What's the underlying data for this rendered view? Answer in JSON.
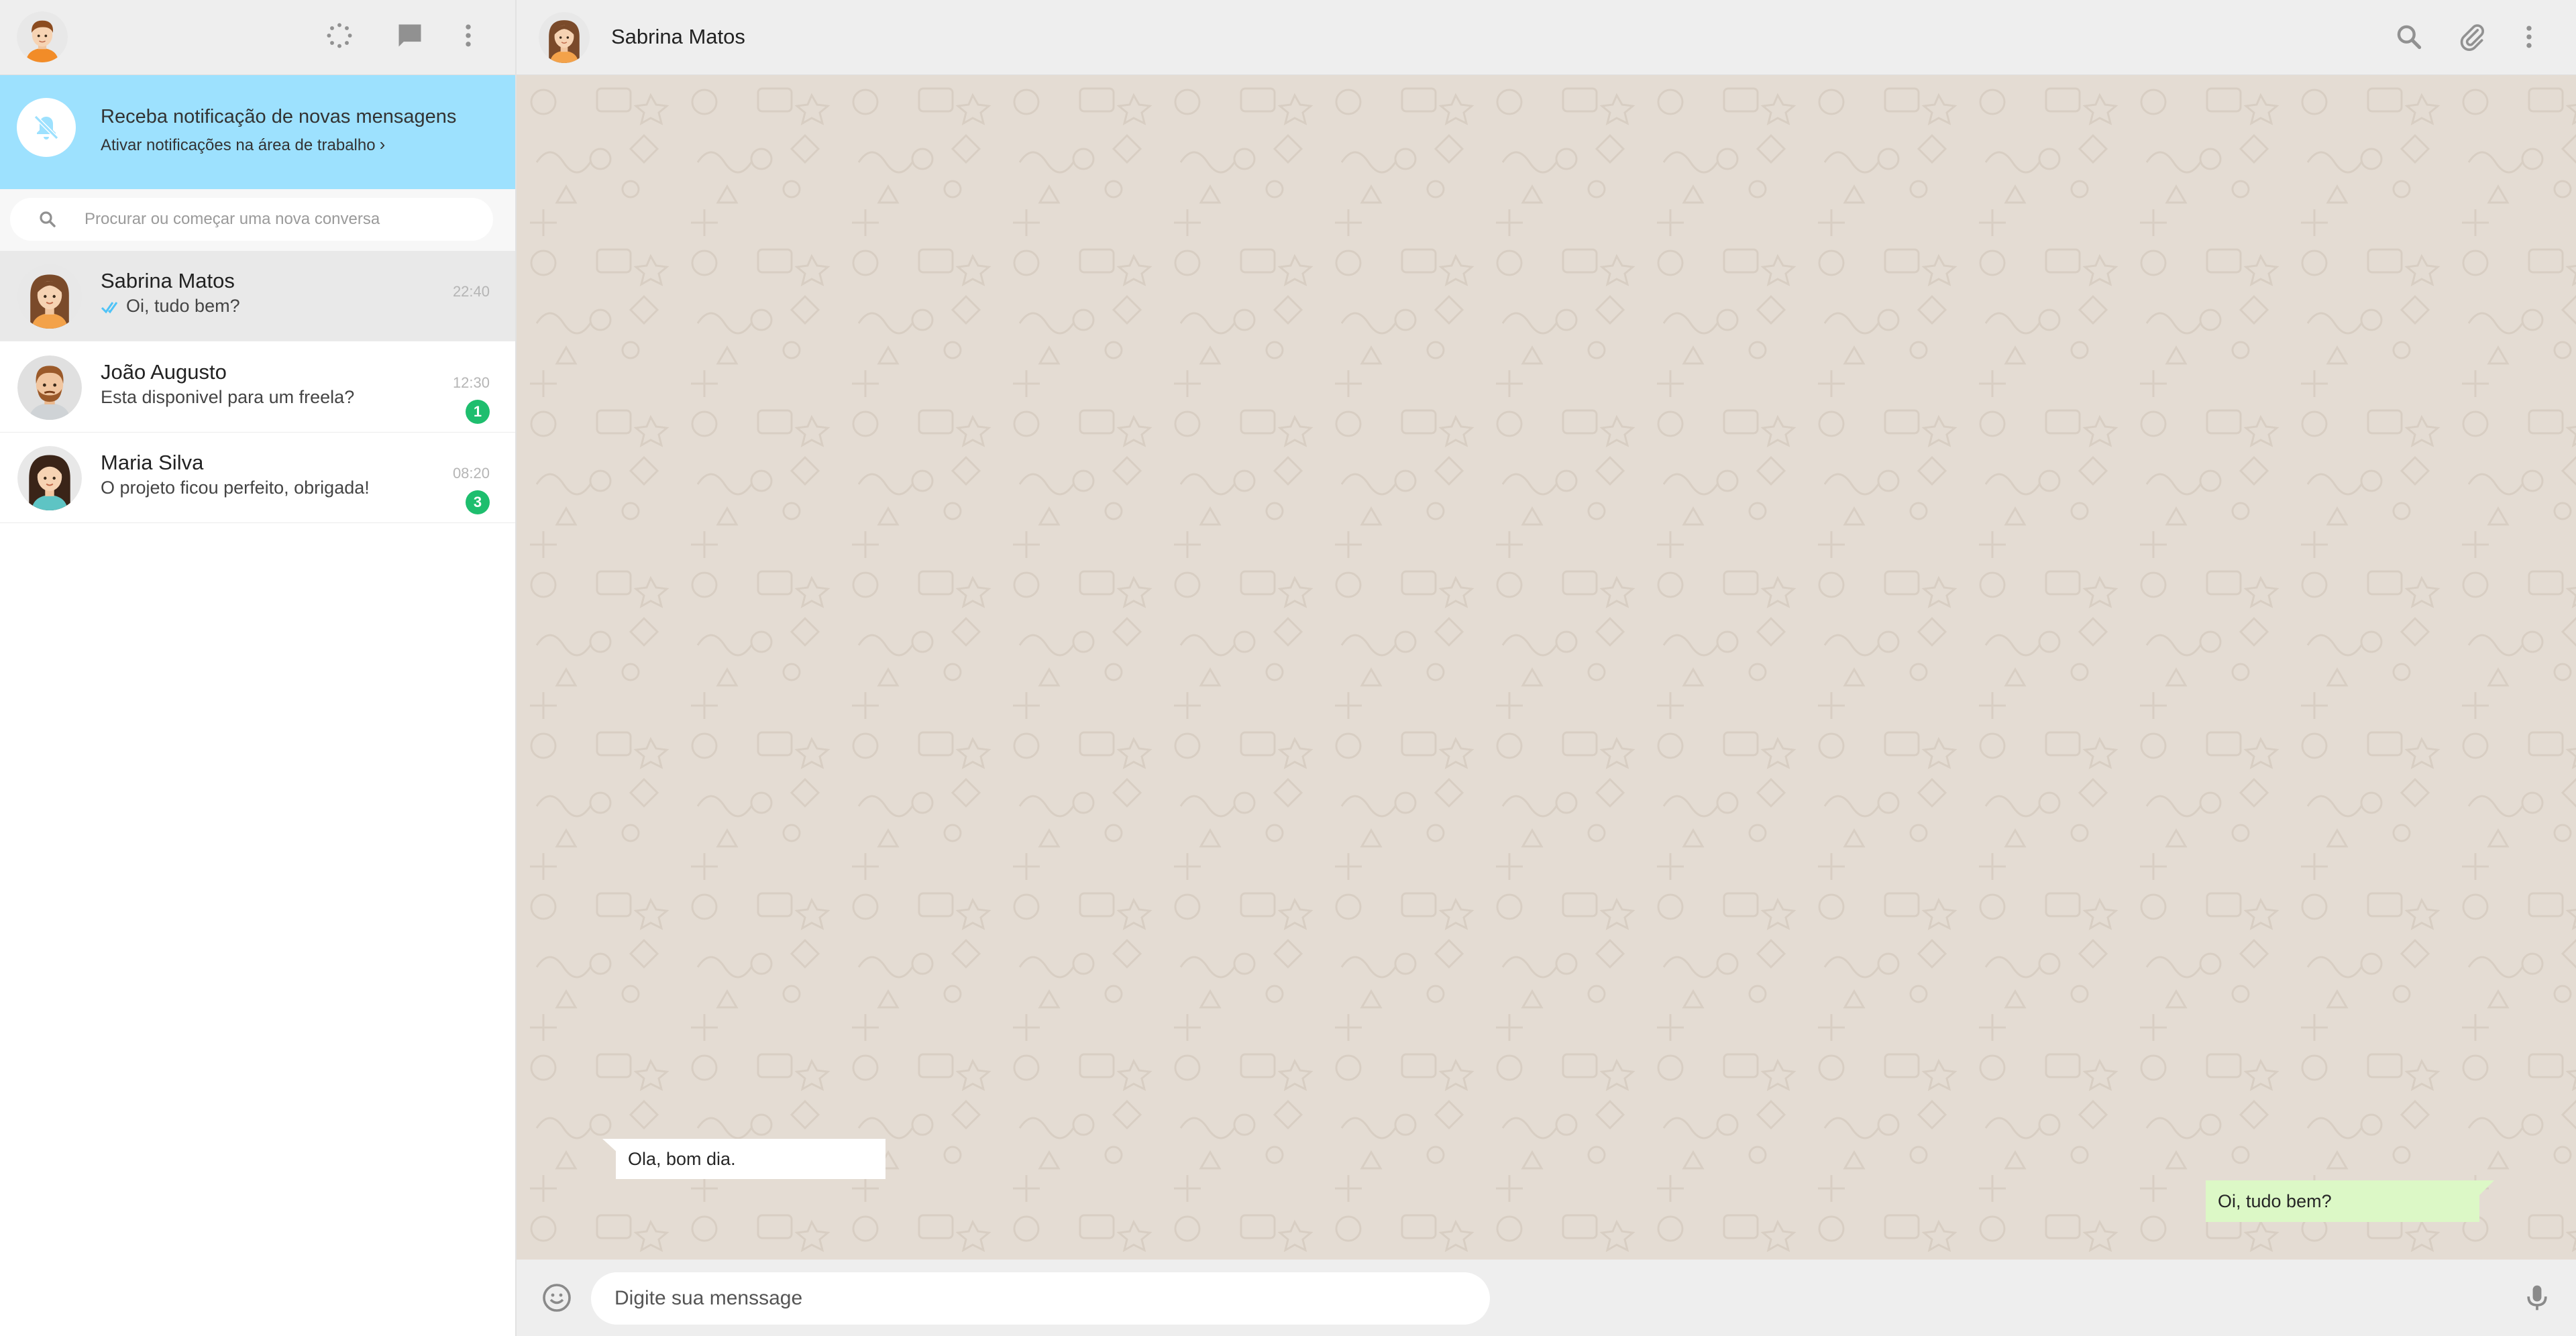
{
  "colors": {
    "header_bg": "#eeeeee",
    "notification_bg": "#9de1fe",
    "chat_wallpaper": "#e4dcd3",
    "outgoing_bubble": "#dcf8c6",
    "incoming_bubble": "#ffffff",
    "unread_badge": "#1ebe6e",
    "read_tick": "#4fc3f7",
    "icon_gray": "#919191"
  },
  "sidebar": {
    "header": {
      "avatar_icon": "user-avatar",
      "icons": [
        "status-icon",
        "new-chat-icon",
        "menu-icon"
      ]
    },
    "notification": {
      "icon": "notifications-off-icon",
      "title": "Receba notificação de novas mensagens",
      "link": "Ativar notificações na área de trabalho",
      "link_chevron": "›"
    },
    "search": {
      "icon": "search-icon",
      "placeholder": "Procurar ou começar uma nova conversa"
    },
    "chats": [
      {
        "name": "Sabrina Matos",
        "last_message": "Oi, tudo bem?",
        "time": "22:40",
        "unread": "",
        "read_ticks": true,
        "active": true
      },
      {
        "name": "João Augusto",
        "last_message": "Esta disponivel para um freela?",
        "time": "12:30",
        "unread": "1",
        "read_ticks": false,
        "active": false
      },
      {
        "name": "Maria Silva",
        "last_message": "O projeto ficou perfeito, obrigada!",
        "time": "08:20",
        "unread": "3",
        "read_ticks": false,
        "active": false
      }
    ]
  },
  "conversation": {
    "header": {
      "contact_name": "Sabrina Matos",
      "icons": [
        "search-icon",
        "attach-icon",
        "menu-icon"
      ]
    },
    "messages": [
      {
        "direction": "incoming",
        "text": "Ola, bom dia."
      },
      {
        "direction": "outgoing",
        "text": "Oi, tudo bem?"
      }
    ],
    "composer": {
      "emoji_icon": "emoji-icon",
      "placeholder": "Digite sua menssage",
      "mic_icon": "microphone-icon"
    }
  }
}
